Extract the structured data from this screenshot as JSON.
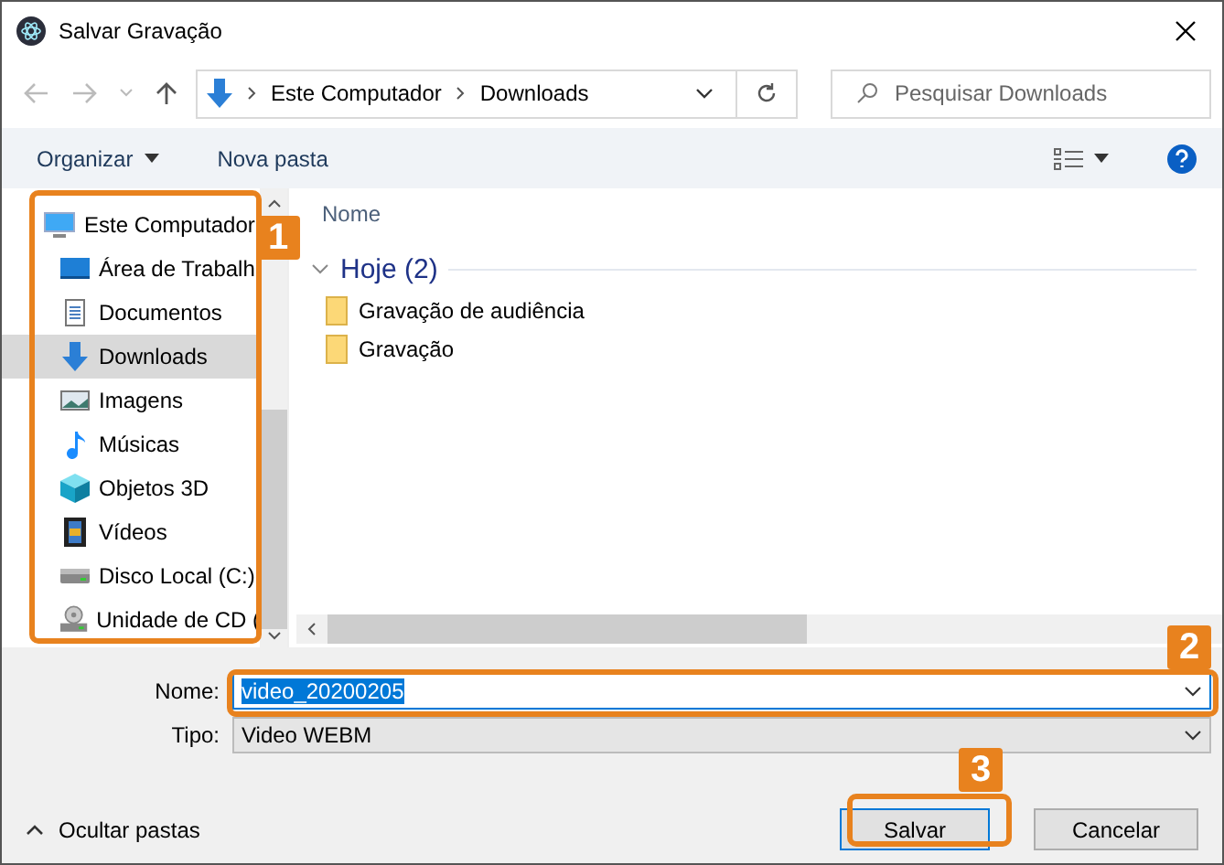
{
  "window": {
    "title": "Salvar Gravação"
  },
  "address": {
    "path": [
      "Este Computador",
      "Downloads"
    ]
  },
  "search": {
    "placeholder": "Pesquisar Downloads"
  },
  "toolbar": {
    "organize": "Organizar",
    "new_folder": "Nova pasta"
  },
  "sidebar": {
    "items": [
      {
        "label": "Este Computador",
        "selected": false,
        "children": [
          {
            "label": "Área de Trabalh",
            "selected": false
          },
          {
            "label": "Documentos",
            "selected": false
          },
          {
            "label": "Downloads",
            "selected": true
          },
          {
            "label": "Imagens",
            "selected": false
          },
          {
            "label": "Músicas",
            "selected": false
          },
          {
            "label": "Objetos 3D",
            "selected": false
          },
          {
            "label": "Vídeos",
            "selected": false
          },
          {
            "label": "Disco Local (C:)",
            "selected": false
          },
          {
            "label": "Unidade de CD (",
            "selected": false
          }
        ]
      }
    ]
  },
  "content": {
    "column": "Nome",
    "group": {
      "label": "Hoje (2)",
      "expanded": true
    },
    "files": [
      {
        "name": "Gravação de audiência"
      },
      {
        "name": "Gravação"
      }
    ]
  },
  "form": {
    "name_label": "Nome:",
    "name_value": "video_20200205",
    "name_value_selected": true,
    "type_label": "Tipo:",
    "type_value": "Video WEBM"
  },
  "footer": {
    "hide_folders": "Ocultar pastas",
    "save": "Salvar",
    "cancel": "Cancelar"
  },
  "annotations": [
    {
      "label": "1"
    },
    {
      "label": "2"
    },
    {
      "label": "3"
    }
  ]
}
